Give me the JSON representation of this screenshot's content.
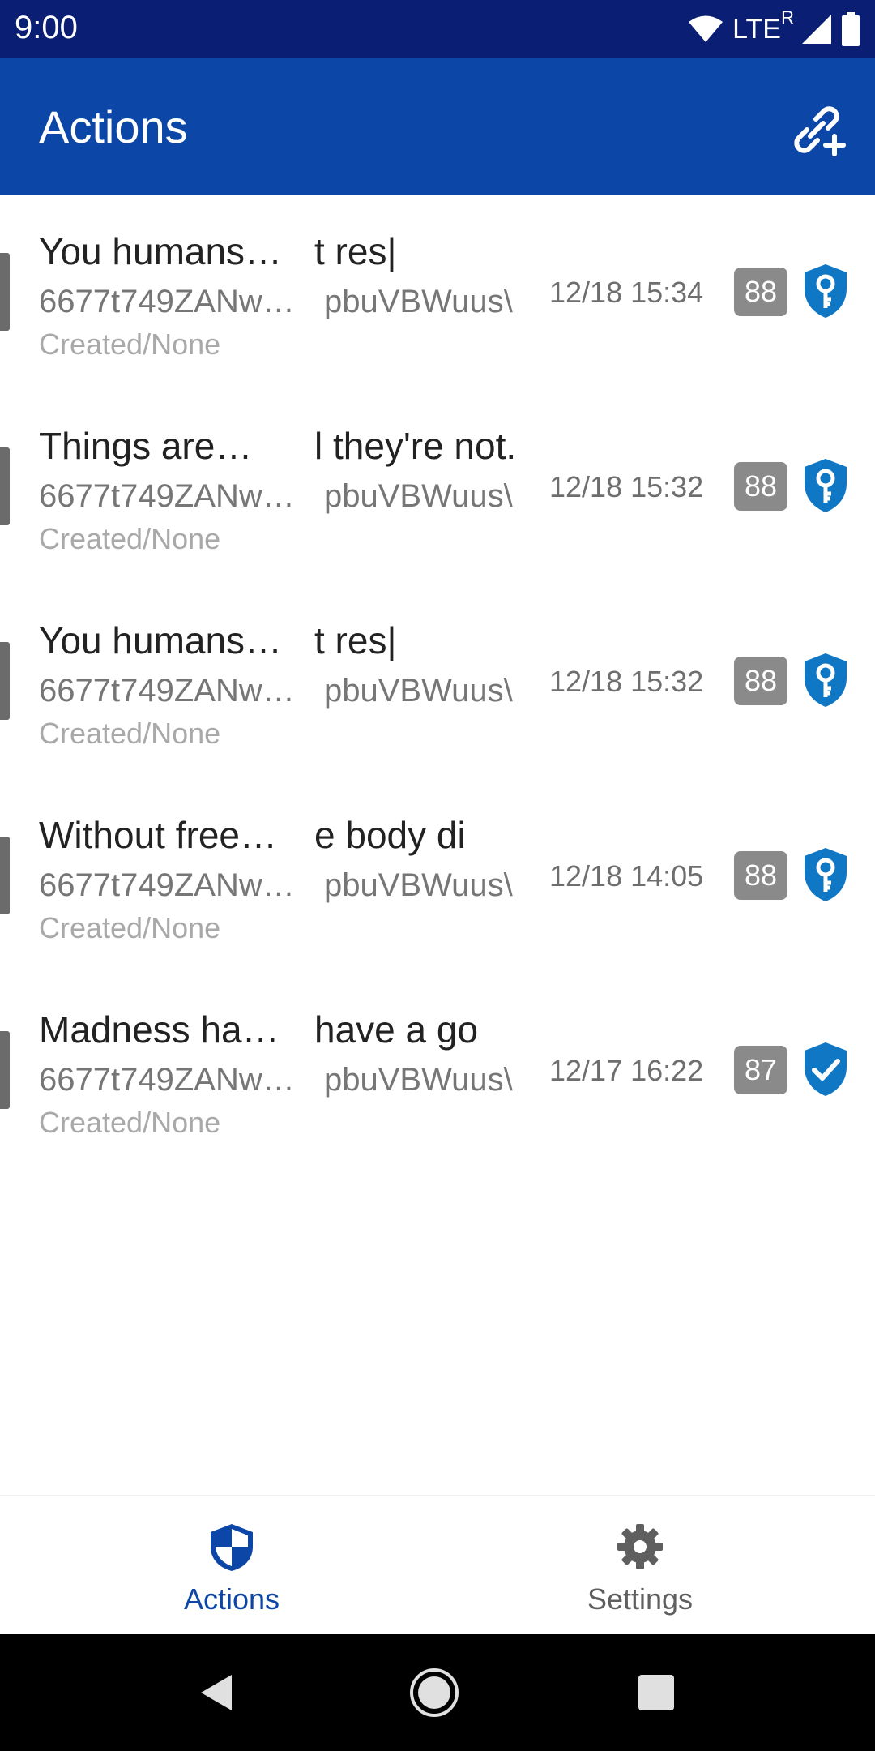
{
  "status_bar": {
    "time": "9:00",
    "network": "LTE",
    "roaming": "R"
  },
  "app_bar": {
    "title": "Actions"
  },
  "colors": {
    "brand": "#0c46a6",
    "status_bar": "#0a1f73",
    "shield": "#0f77c4",
    "badge": "#8a8a8a"
  },
  "actions": [
    {
      "title_start": "You humans…",
      "title_end": "t res|",
      "id_start": "6677t749ZANw…",
      "id_end": "pbuVBWuus\\",
      "meta": "Created/None",
      "date": "12/18 15:34",
      "badge": "88",
      "icon": "shield-key-icon"
    },
    {
      "title_start": "Things are…",
      "title_end": "l they're not.",
      "id_start": "6677t749ZANw…",
      "id_end": "pbuVBWuus\\",
      "meta": "Created/None",
      "date": "12/18 15:32",
      "badge": "88",
      "icon": "shield-key-icon"
    },
    {
      "title_start": "You humans…",
      "title_end": "t res|",
      "id_start": "6677t749ZANw…",
      "id_end": "pbuVBWuus\\",
      "meta": "Created/None",
      "date": "12/18 15:32",
      "badge": "88",
      "icon": "shield-key-icon"
    },
    {
      "title_start": "Without free…",
      "title_end": "e body di",
      "id_start": "6677t749ZANw…",
      "id_end": "pbuVBWuus\\",
      "meta": "Created/None",
      "date": "12/18 14:05",
      "badge": "88",
      "icon": "shield-key-icon"
    },
    {
      "title_start": "Madness ha…",
      "title_end": "have a go",
      "id_start": "6677t749ZANw…",
      "id_end": "pbuVBWuus\\",
      "meta": "Created/None",
      "date": "12/17 16:22",
      "badge": "87",
      "icon": "shield-check-icon"
    }
  ],
  "bottom_nav": [
    {
      "label": "Actions",
      "icon": "shield-icon",
      "active": true
    },
    {
      "label": "Settings",
      "icon": "gear-icon",
      "active": false
    }
  ]
}
